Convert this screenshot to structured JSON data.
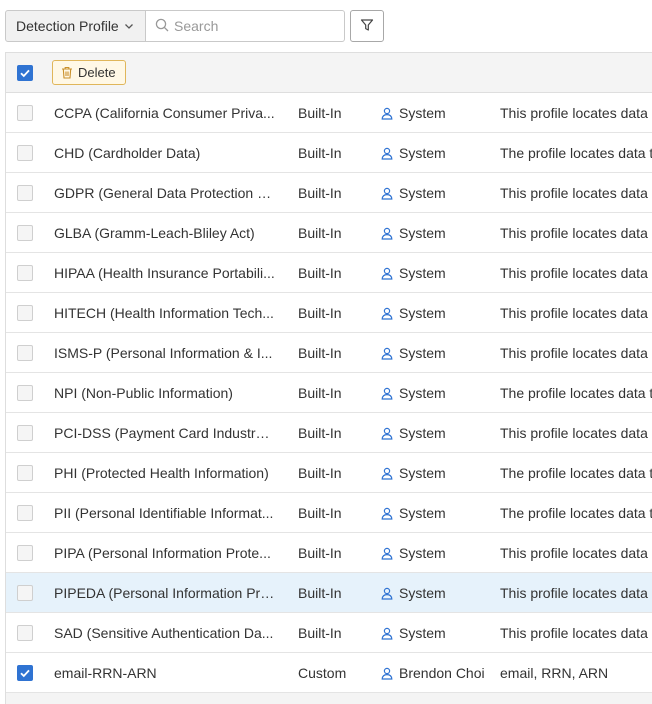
{
  "toolbar": {
    "dropdown_label": "Detection Profile",
    "search_placeholder": "Search"
  },
  "actions": {
    "delete_label": "Delete"
  },
  "rows": [
    {
      "name": "CCPA (California Consumer Priva...",
      "type": "Built-In",
      "owner": "System",
      "description": "This profile locates data c",
      "checked": false
    },
    {
      "name": "CHD (Cardholder Data)",
      "type": "Built-In",
      "owner": "System",
      "description": "The profile locates data t",
      "checked": false
    },
    {
      "name": "GDPR (General Data Protection R...",
      "type": "Built-In",
      "owner": "System",
      "description": "This profile locates data c",
      "checked": false
    },
    {
      "name": "GLBA (Gramm-Leach-Bliley Act)",
      "type": "Built-In",
      "owner": "System",
      "description": "This profile locates data c",
      "checked": false
    },
    {
      "name": "HIPAA (Health Insurance Portabili...",
      "type": "Built-In",
      "owner": "System",
      "description": "This profile locates data c",
      "checked": false
    },
    {
      "name": "HITECH (Health Information Tech...",
      "type": "Built-In",
      "owner": "System",
      "description": "This profile locates data c",
      "checked": false
    },
    {
      "name": "ISMS-P (Personal Information & I...",
      "type": "Built-In",
      "owner": "System",
      "description": "This profile locates data c",
      "checked": false
    },
    {
      "name": "NPI (Non-Public Information)",
      "type": "Built-In",
      "owner": "System",
      "description": "The profile locates data t",
      "checked": false
    },
    {
      "name": "PCI-DSS (Payment Card Industry ...",
      "type": "Built-In",
      "owner": "System",
      "description": "This profile locates data c",
      "checked": false
    },
    {
      "name": "PHI (Protected Health Information)",
      "type": "Built-In",
      "owner": "System",
      "description": "The profile locates data t",
      "checked": false
    },
    {
      "name": "PII (Personal Identifiable Informat...",
      "type": "Built-In",
      "owner": "System",
      "description": "The profile locates data t",
      "checked": false
    },
    {
      "name": "PIPA (Personal Information Prote...",
      "type": "Built-In",
      "owner": "System",
      "description": "This profile locates data c",
      "checked": false
    },
    {
      "name": "PIPEDA (Personal Information Pro...",
      "type": "Built-In",
      "owner": "System",
      "description": "This profile locates data c",
      "checked": false,
      "hover": true
    },
    {
      "name": "SAD (Sensitive Authentication Da...",
      "type": "Built-In",
      "owner": "System",
      "description": "This profile locates data c",
      "checked": false
    },
    {
      "name": "email-RRN-ARN",
      "type": "Custom",
      "owner": "Brendon Choi",
      "description": "email, RRN, ARN",
      "checked": true
    }
  ],
  "colors": {
    "accent": "#2f73d2",
    "hover_row": "#e6f2fb",
    "delete_border": "#e0b65a"
  }
}
